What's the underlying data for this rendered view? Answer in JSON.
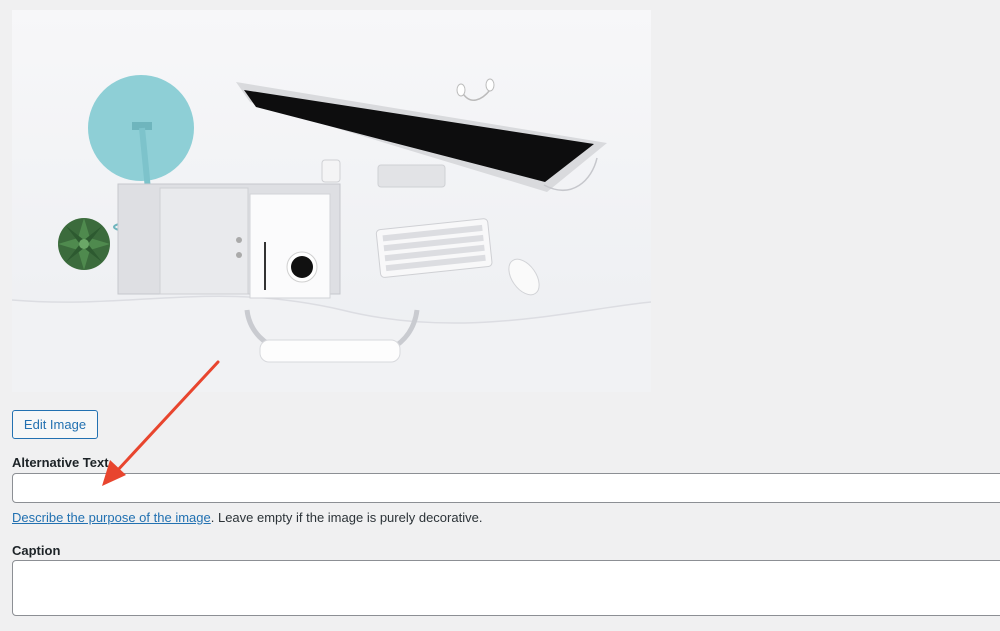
{
  "media": {
    "edit_button_label": "Edit Image"
  },
  "alt_text": {
    "label": "Alternative Text",
    "value": "",
    "help_link_text": "Describe the purpose of the image",
    "help_rest": ". Leave empty if the image is purely decorative."
  },
  "caption": {
    "label": "Caption",
    "value": ""
  },
  "colors": {
    "accent": "#2271b1",
    "arrow": "#e8452e",
    "border": "#8c8f94",
    "background": "#f0f0f1"
  },
  "icons": {
    "annotation": "red-arrow-icon"
  }
}
